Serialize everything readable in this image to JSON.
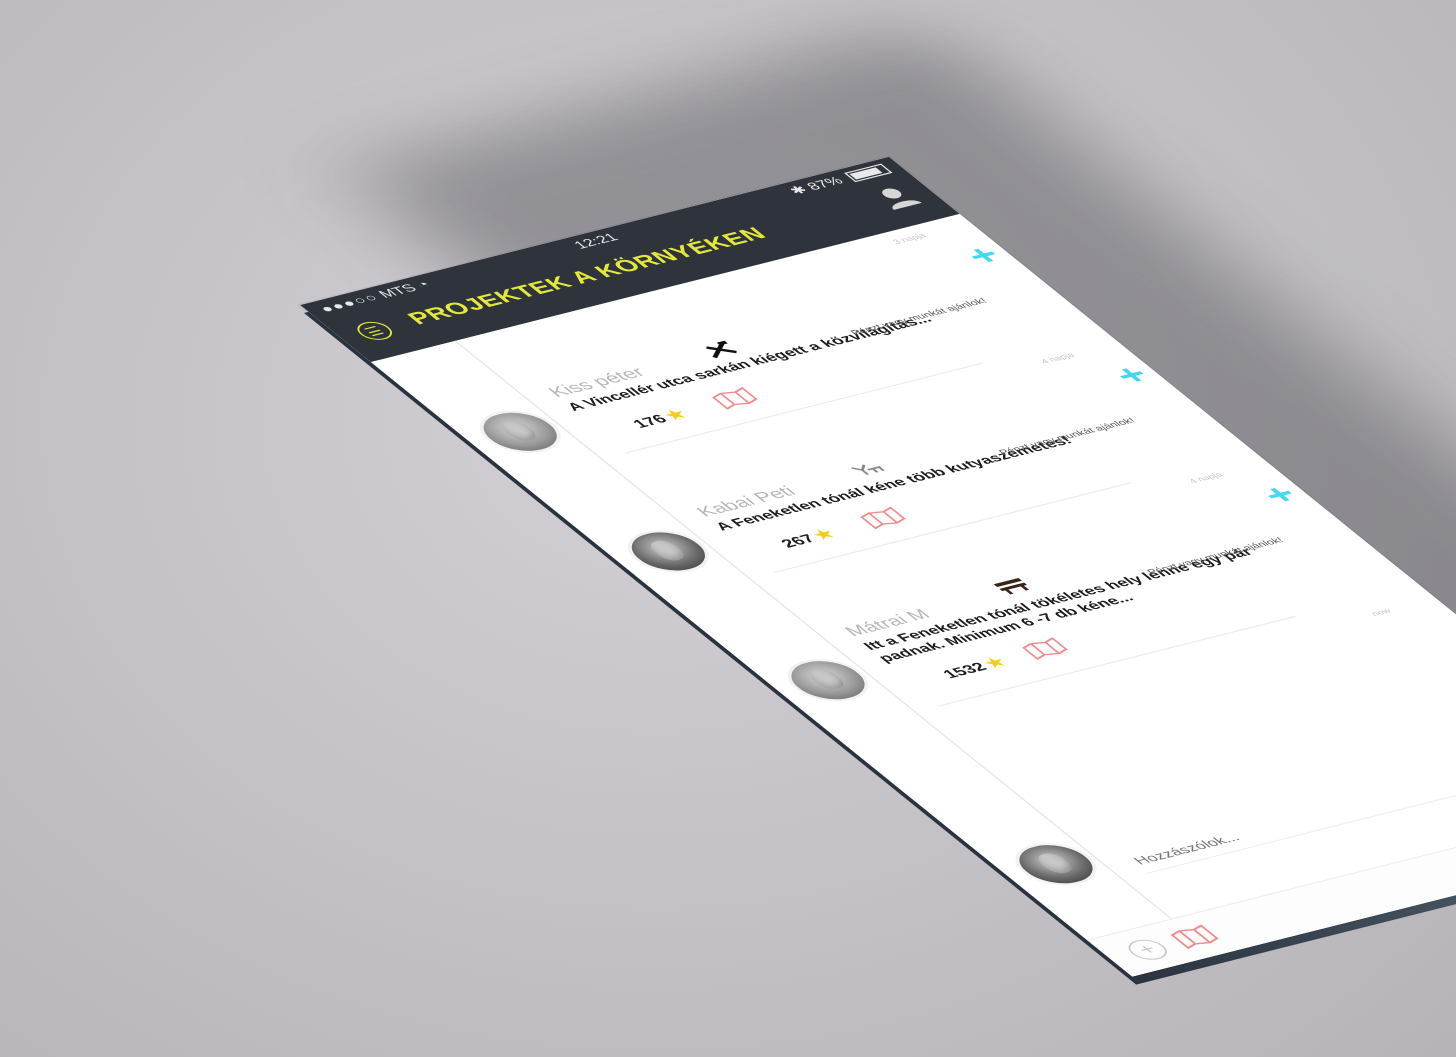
{
  "status": {
    "carrier": "MTS",
    "time": "12:21",
    "battery": "87%"
  },
  "header": {
    "title": "PROJEKTEK A KÖRNYÉKEN"
  },
  "posts": [
    {
      "author": "Kiss péter",
      "category_icon": "tools-icon",
      "time_ago": "3 napja",
      "text": "A Vincellér utca sarkán kiégett a közvilágítás...",
      "offer_label": "Pénzt vagy munkát ajánlok!",
      "stars": "176"
    },
    {
      "author": "Kabai Peti",
      "category_icon": "dog-icon",
      "time_ago": "4 napja",
      "text": "A Feneketlen tónál kéne több kutyaszemetes!",
      "offer_label": "Pénzt vagy munkát ajánlok!",
      "stars": "267"
    },
    {
      "author": "Mátrai M",
      "category_icon": "bench-icon",
      "time_ago": "4 napja",
      "text": "Itt a Feneketlen tónál tökéletes hely lenne egy pár padnak. Minimum 6 -7 db kéne...",
      "offer_label": "Pénzt vagy munkát ajánlok!",
      "stars": "1532"
    }
  ],
  "comment": {
    "time_ago": "now",
    "placeholder": "Hozzászólok..."
  },
  "colors": {
    "accent": "#e3e83a",
    "header_bg": "#2e333c",
    "plus": "#45d7f0",
    "map": "#f08c8c",
    "star": "#f3cf1c"
  }
}
